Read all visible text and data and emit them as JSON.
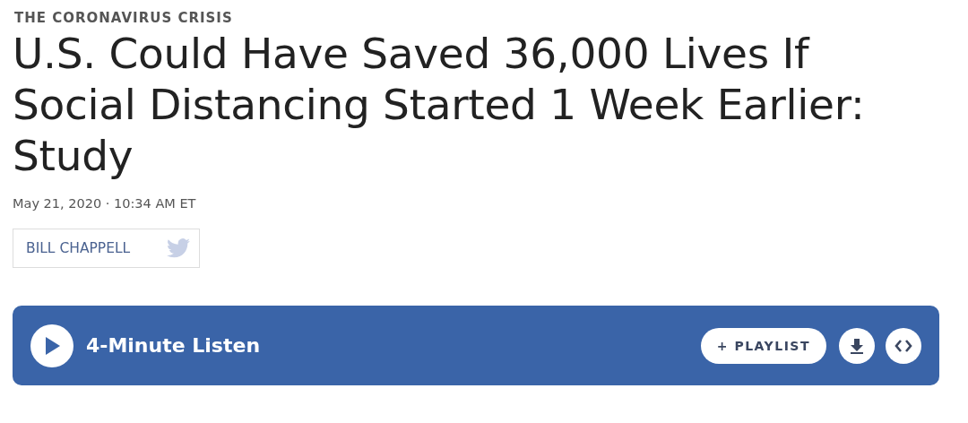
{
  "kicker": "THE CORONAVIRUS CRISIS",
  "headline": "U.S. Could Have Saved 36,000 Lives If Social Distancing Started 1 Week Earlier: Study",
  "dateline": "May 21, 2020 · 10:34 AM ET",
  "author": {
    "name": "BILL CHAPPELL"
  },
  "player": {
    "label": "4-Minute Listen",
    "playlist_button": {
      "icon": "+",
      "label": "PLAYLIST"
    },
    "actions": [
      {
        "kind": "download"
      },
      {
        "kind": "embed"
      }
    ]
  }
}
